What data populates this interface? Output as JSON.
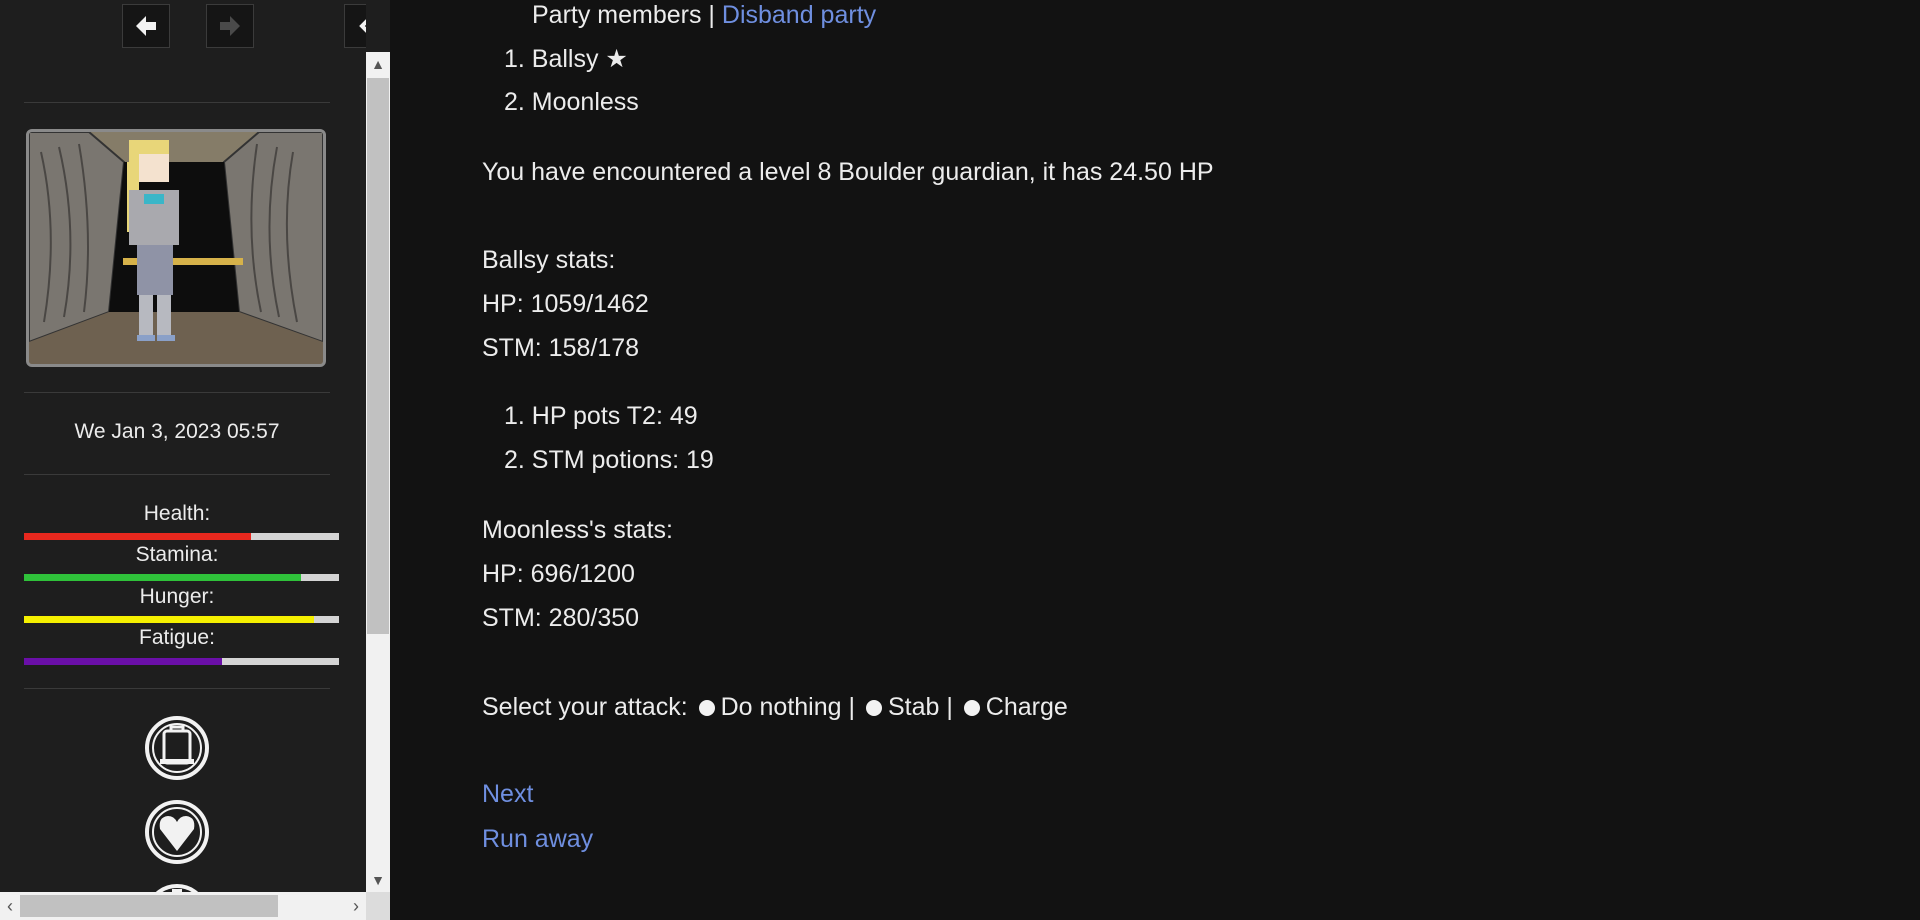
{
  "sidebar": {
    "nav": {
      "back": "arrow-left-icon",
      "forward": "arrow-right-icon",
      "collapse": "chevron-left-icon"
    },
    "date": "We Jan 3, 2023 05:57",
    "bars": [
      {
        "label": "Health:",
        "value": 0.72,
        "color": "#e8281e"
      },
      {
        "label": "Stamina:",
        "value": 0.88,
        "color": "#2fc23a"
      },
      {
        "label": "Hunger:",
        "value": 0.92,
        "color": "#f5f000"
      },
      {
        "label": "Fatigue:",
        "value": 0.63,
        "color": "#6a0fa8"
      }
    ],
    "icons": [
      "backpack-icon",
      "heart-icon",
      "shield-icon"
    ]
  },
  "party": {
    "heading": "Party members |",
    "disband": "Disband party",
    "members": [
      "Ballsy ★",
      "Moonless"
    ]
  },
  "encounter": "You have encountered a level 8 Boulder guardian, it has 24.50 HP",
  "stats": [
    {
      "heading": "Ballsy stats:",
      "hp": "HP: 1059/1462",
      "stm": "STM: 158/178"
    },
    {
      "heading": "Moonless's stats:",
      "hp": "HP: 696/1200",
      "stm": "STM: 280/350"
    }
  ],
  "items": [
    "HP pots T2: 49",
    "STM potions: 19"
  ],
  "attack": {
    "label": "Select your attack:",
    "options": [
      "Do nothing",
      "Stab",
      "Charge"
    ],
    "separator": "|"
  },
  "links": {
    "next": "Next",
    "run": "Run away"
  }
}
